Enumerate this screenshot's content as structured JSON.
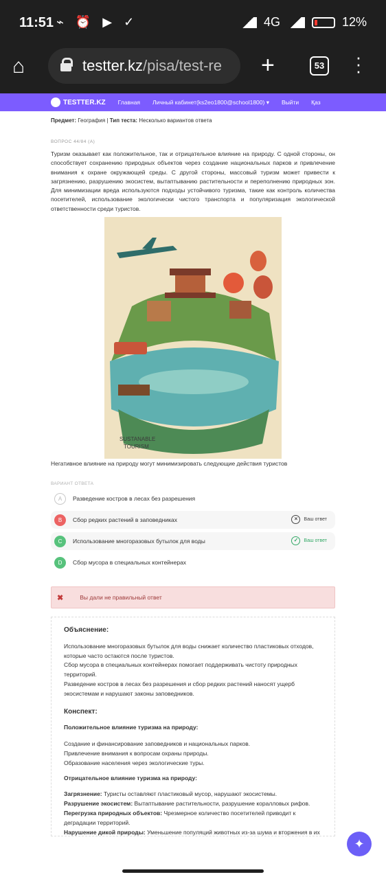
{
  "statusbar": {
    "time": "11:51",
    "icons": "⌁ ⏰ ▶ ✓",
    "network": "4G",
    "battery": "12%"
  },
  "browser": {
    "url_host": "testter.kz",
    "url_path": "/pisa/test-re",
    "tab_count": "53"
  },
  "nav": {
    "logo": "TESTTER.KZ",
    "links": [
      "Главная",
      "Личный кабинет(ks2eo1800@school1800) ▾",
      "Выйти",
      "Қаз"
    ]
  },
  "meta": {
    "subject_label": "Предмет:",
    "subject": "География",
    "type_label": "Тип теста:",
    "type": "Несколько вариантов ответа"
  },
  "question": {
    "number": "ВОПРОС 44/84 (A)",
    "text": "Туризм оказывает как положительное, так и отрицательное влияние на природу. С одной стороны, он способствует сохранению природных объектов через создание национальных парков и привлечение внимания к охране окружающей среды. С другой стороны, массовый туризм может привести к загрязнению, разрушению экосистем, вытаптыванию растительности и переполнению природных зон. Для минимизации вреда используются подходы устойчивого туризма, такие как контроль количества посетителей, использование экологически чистого транспорта и популяризация экологической ответственности среди туристов.",
    "image_caption": "SUSTANABLE\nTOURISM",
    "prompt": "Негативное влияние на природу могут минимизировать следующие действия туристов"
  },
  "answers": {
    "label": "ВАРИАНТ ОТВЕТА",
    "options": [
      {
        "letter": "A",
        "text": "Разведение костров в лесах без разрешения",
        "state": "neutral",
        "badge": ""
      },
      {
        "letter": "B",
        "text": "Сбор редких растений в заповедниках",
        "state": "wrong",
        "badge": "Ваш ответ"
      },
      {
        "letter": "C",
        "text": "Использование многоразовых бутылок для воды",
        "state": "right",
        "badge": "Ваш ответ"
      },
      {
        "letter": "D",
        "text": "Сбор мусора в специальных контейнерах",
        "state": "right",
        "badge": ""
      }
    ]
  },
  "result": {
    "text": "Вы дали не правильный ответ"
  },
  "explanation": {
    "title": "Объяснение:",
    "lines": [
      "Использование многоразовых бутылок для воды снижает количество пластиковых отходов, которые часто остаются после туристов.",
      "Сбор мусора в специальных контейнерах помогает поддерживать чистоту природных территорий.",
      "Разведение костров в лесах без разрешения и сбор редких растений наносят ущерб экосистемам и нарушают законы заповедников."
    ],
    "konspekt_title": "Конспект:",
    "positive_title": "Положительное влияние туризма на природу:",
    "positive": [
      "Создание и финансирование заповедников и национальных парков.",
      "Привлечение внимания к вопросам охраны природы.",
      "Образование населения через экологические туры."
    ],
    "negative_title": "Отрицательное влияние туризма на природу:",
    "negative": [
      {
        "term": "Загрязнение:",
        "text": " Туристы оставляют пластиковый мусор, нарушают экосистемы."
      },
      {
        "term": "Разрушение экосистем:",
        "text": " Вытаптывание растительности, разрушение коралловых рифов."
      },
      {
        "term": "Перегрузка природных объектов:",
        "text": " Чрезмерное количество посетителей приводит к деградации территорий."
      },
      {
        "term": "Нарушение дикой природы:",
        "text": " Уменьшение популяций животных из-за шума и вторжения в их среду обитания."
      }
    ]
  },
  "colors": {
    "nav": "#7c5cff",
    "wrong": "#ec6363",
    "right": "#57c27c",
    "fab": "#6c5ff7"
  }
}
